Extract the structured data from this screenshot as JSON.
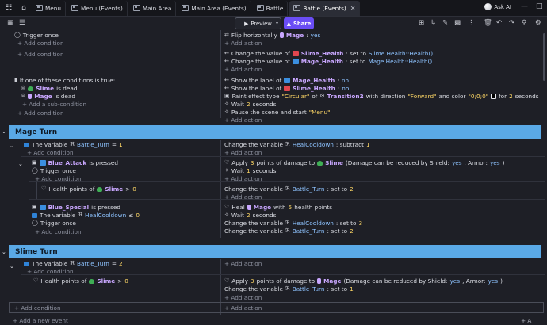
{
  "tabs": [
    {
      "label": "Menu",
      "active": false
    },
    {
      "label": "Menu (Events)",
      "active": false
    },
    {
      "label": "Main Area",
      "active": false
    },
    {
      "label": "Main Area (Events)",
      "active": false
    },
    {
      "label": "Battle",
      "active": false
    },
    {
      "label": "Battle (Events)",
      "active": true
    }
  ],
  "topbar": {
    "ask_ai": "Ask AI"
  },
  "toolbar": {
    "preview": "Preview",
    "share": "Share"
  },
  "colors": {
    "group_header": "#5aa9e6",
    "share_button": "#6a4df5",
    "variable": "#8ec3ff",
    "object": "#c9a7ff",
    "value": "#ffd866"
  },
  "labels": {
    "add_condition": "+ Add condition",
    "add_action": "+ Add action",
    "add_subcondition": "+ Add a sub-condition",
    "add_new_event": "+ Add a new event"
  },
  "events": {
    "e1": {
      "cond": "Trigger once",
      "act_prefix": "Flip horizontally",
      "act_obj": "Mage",
      "act_suffix": ":",
      "act_val": "yes"
    },
    "e2": {
      "act1_prefix": "Change the value of",
      "act1_obj": "Slime_Health",
      "act1_mid": ": set to",
      "act1_expr": "Slime.Health::Health()",
      "act2_prefix": "Change the value of",
      "act2_obj": "Mage_Health",
      "act2_mid": ": set to",
      "act2_expr": "Mage.Health::Health()"
    },
    "e3": {
      "cond_or": "If one of these conditions is true:",
      "cond1_obj": "Slime",
      "cond1_suffix": "is dead",
      "cond2_obj": "Mage",
      "cond2_suffix": "is dead",
      "act1_prefix": "Show the label of",
      "act1_obj": "Mage_Health",
      "act1_suffix": ":",
      "act1_val": "no",
      "act2_prefix": "Show the label of",
      "act2_obj": "Slime_Health",
      "act2_suffix": ":",
      "act2_val": "no",
      "act3_prefix": "Paint effect type",
      "act3_type": "\"Circular\"",
      "act3_of": "of",
      "act3_obj": "Transition2",
      "act3_dir_prefix": "with direction",
      "act3_dir": "\"Forward\"",
      "act3_color_prefix": "and color",
      "act3_color": "\"0;0;0\"",
      "act3_for": "for",
      "act3_secs": "2",
      "act3_secs_suffix": "seconds",
      "act4_prefix": "Wait",
      "act4_num": "2",
      "act4_suffix": "seconds",
      "act5_prefix": "Pause the scene and start",
      "act5_val": "\"Menu\""
    },
    "group_mage": "Mage Turn",
    "m1": {
      "cond_prefix": "The variable",
      "cond_var": "Battle_Turn",
      "cond_op": "=",
      "cond_num": "1",
      "act_prefix": "Change the variable",
      "act_var": "HealCooldown",
      "act_mid": ": subtract",
      "act_num": "1"
    },
    "m2": {
      "cond1_obj": "Blue_Attack",
      "cond1_suffix": "is pressed",
      "cond2": "Trigger once",
      "act1_prefix": "Apply",
      "act1_num": "3",
      "act1_mid": "points of damage to",
      "act1_obj": "Slime",
      "act1_paren_prefix": "(Damage can be reduced by Shield:",
      "act1_shield": "yes",
      "act1_armor_prefix": ", Armor:",
      "act1_armor": "yes",
      "act1_paren_suffix": ")",
      "act2_prefix": "Wait",
      "act2_num": "1",
      "act2_suffix": "seconds"
    },
    "m3": {
      "cond_prefix": "Health points of",
      "cond_obj": "Slime",
      "cond_op": ">",
      "cond_num": "0",
      "act_prefix": "Change the variable",
      "act_var": "Battle_Turn",
      "act_mid": ": set to",
      "act_num": "2"
    },
    "m4": {
      "cond1_obj": "Blue_Special",
      "cond1_suffix": "is pressed",
      "cond2_prefix": "The variable",
      "cond2_var": "HealCooldown",
      "cond2_op": "≤",
      "cond2_num": "0",
      "cond3": "Trigger once",
      "act1_prefix": "Heal",
      "act1_obj": "Mage",
      "act1_mid": "with",
      "act1_num": "5",
      "act1_suffix": "health points",
      "act2_prefix": "Wait",
      "act2_num": "2",
      "act2_suffix": "seconds",
      "act3_prefix": "Change the variable",
      "act3_var": "HealCooldown",
      "act3_mid": ": set to",
      "act3_num": "3",
      "act4_prefix": "Change the variable",
      "act4_var": "Battle_Turn",
      "act4_mid": ": set to",
      "act4_num": "2"
    },
    "group_slime": "Slime Turn",
    "s1": {
      "cond_prefix": "The variable",
      "cond_var": "Battle_Turn",
      "cond_op": "=",
      "cond_num": "2"
    },
    "s2": {
      "cond_prefix": "Health points of",
      "cond_obj": "Slime",
      "cond_op": ">",
      "cond_num": "0",
      "act1_prefix": "Apply",
      "act1_num": "3",
      "act1_mid": "points of damage to",
      "act1_obj": "Mage",
      "act1_paren_prefix": "(Damage can be reduced by Shield:",
      "act1_shield": "yes",
      "act1_armor_prefix": ", Armor:",
      "act1_armor": "yes",
      "act1_paren_suffix": ")",
      "act2_prefix": "Change the variable",
      "act2_var": "Battle_Turn",
      "act2_mid": ": set to",
      "act2_num": "1"
    }
  }
}
